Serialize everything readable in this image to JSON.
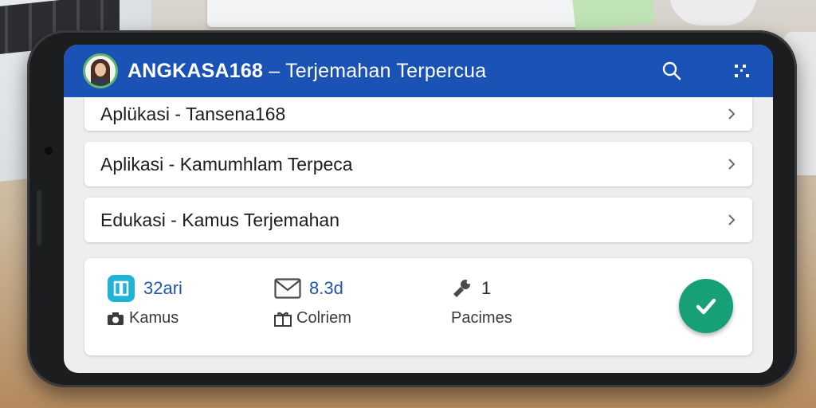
{
  "app": {
    "brand": "ANGKASA168",
    "separator": " – ",
    "subtitle": "Terjemahan Terpercua",
    "avatar_icon": "user-avatar",
    "accent_color": "#1a52b5"
  },
  "toolbar": {
    "search_icon": "search-icon",
    "more_icon": "more-dots-icon"
  },
  "list": {
    "items": [
      {
        "label": "Aplükasi - Tansena168"
      },
      {
        "label": "Aplikasi - Kamumhlam Terpeca"
      },
      {
        "label": "Edukasi - Kamus Terjemahan"
      }
    ]
  },
  "stats": {
    "items": [
      {
        "icon": "dictionary-app-icon",
        "value": "32ari",
        "label_icon": "camera-icon",
        "label": "Kamus"
      },
      {
        "icon": "mail-icon",
        "value": "8.3d",
        "label_icon": "gift-icon",
        "label": "Colriem"
      },
      {
        "icon": "tool-icon",
        "value": "1",
        "label": "Pacimes"
      }
    ],
    "confirm_icon": "check-icon",
    "confirm_color": "#17a078"
  }
}
